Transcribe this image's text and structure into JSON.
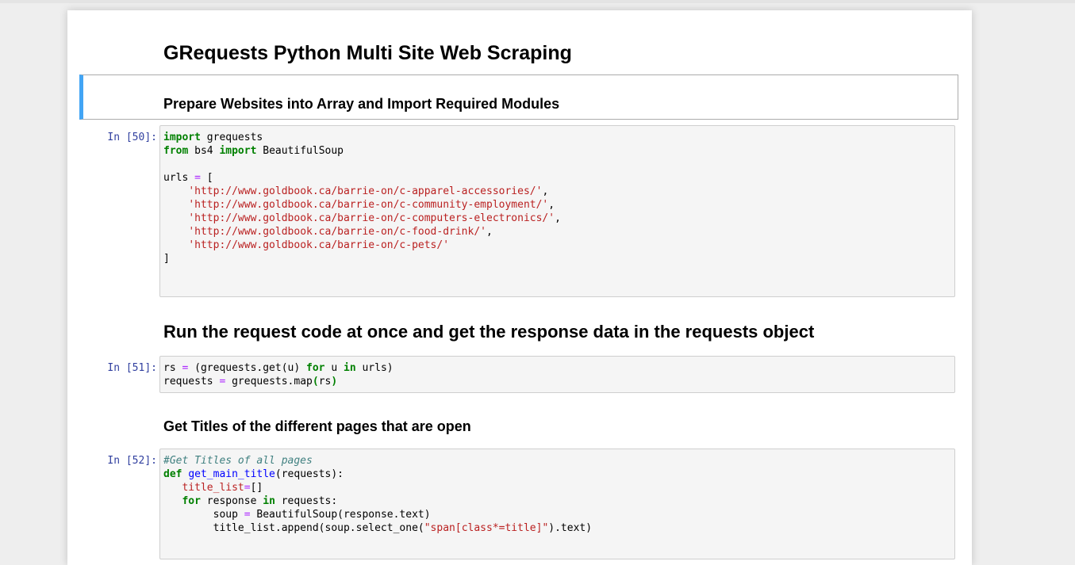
{
  "notebook": {
    "title": "GRequests Python Multi Site Web Scraping",
    "section1": "Prepare Websites into Array and Import Required Modules",
    "section2": "Run the request code at once and get the response data in the requests object",
    "section3": "Get Titles of the different pages that are open"
  },
  "cells": [
    {
      "prompt": "In [50]:",
      "lines": [
        [
          {
            "t": "import",
            "c": "kw"
          },
          {
            "t": " grequests",
            "c": ""
          }
        ],
        [
          {
            "t": "from",
            "c": "kw"
          },
          {
            "t": " bs4 ",
            "c": ""
          },
          {
            "t": "import",
            "c": "kw"
          },
          {
            "t": " BeautifulSoup",
            "c": ""
          }
        ],
        [],
        [
          {
            "t": "urls ",
            "c": ""
          },
          {
            "t": "=",
            "c": "op"
          },
          {
            "t": " [",
            "c": ""
          }
        ],
        [
          {
            "t": "    ",
            "c": ""
          },
          {
            "t": "'http://www.goldbook.ca/barrie-on/c-apparel-accessories/'",
            "c": "str"
          },
          {
            "t": ",",
            "c": ""
          }
        ],
        [
          {
            "t": "    ",
            "c": ""
          },
          {
            "t": "'http://www.goldbook.ca/barrie-on/c-community-employment/'",
            "c": "str"
          },
          {
            "t": ",",
            "c": ""
          }
        ],
        [
          {
            "t": "    ",
            "c": ""
          },
          {
            "t": "'http://www.goldbook.ca/barrie-on/c-computers-electronics/'",
            "c": "str"
          },
          {
            "t": ",",
            "c": ""
          }
        ],
        [
          {
            "t": "    ",
            "c": ""
          },
          {
            "t": "'http://www.goldbook.ca/barrie-on/c-food-drink/'",
            "c": "str"
          },
          {
            "t": ",",
            "c": ""
          }
        ],
        [
          {
            "t": "    ",
            "c": ""
          },
          {
            "t": "'http://www.goldbook.ca/barrie-on/c-pets/'",
            "c": "str"
          }
        ],
        [
          {
            "t": "]",
            "c": ""
          }
        ]
      ]
    },
    {
      "prompt": "In [51]:",
      "lines": [
        [
          {
            "t": "rs ",
            "c": ""
          },
          {
            "t": "=",
            "c": "op"
          },
          {
            "t": " (grequests.get(u) ",
            "c": ""
          },
          {
            "t": "for",
            "c": "kw"
          },
          {
            "t": " u ",
            "c": ""
          },
          {
            "t": "in",
            "c": "kw"
          },
          {
            "t": " urls)",
            "c": ""
          }
        ],
        [
          {
            "t": "requests ",
            "c": ""
          },
          {
            "t": "=",
            "c": "op"
          },
          {
            "t": " grequests.map",
            "c": ""
          },
          {
            "t": "(",
            "c": "kw"
          },
          {
            "t": "rs",
            "c": ""
          },
          {
            "t": ")",
            "c": "kw"
          }
        ]
      ]
    },
    {
      "prompt": "In [52]:",
      "lines": [
        [
          {
            "t": "#Get Titles of all pages",
            "c": "cm"
          }
        ],
        [
          {
            "t": "def",
            "c": "kw"
          },
          {
            "t": " ",
            "c": ""
          },
          {
            "t": "get_main_title",
            "c": "fn"
          },
          {
            "t": "(requests):",
            "c": ""
          }
        ],
        [
          {
            "t": "   ",
            "c": ""
          },
          {
            "t": "title_list",
            "c": "var"
          },
          {
            "t": "=",
            "c": "op"
          },
          {
            "t": "[]",
            "c": ""
          }
        ],
        [
          {
            "t": "   ",
            "c": ""
          },
          {
            "t": "for",
            "c": "kw"
          },
          {
            "t": " response ",
            "c": ""
          },
          {
            "t": "in",
            "c": "kw"
          },
          {
            "t": " requests:",
            "c": ""
          }
        ],
        [
          {
            "t": "        soup ",
            "c": ""
          },
          {
            "t": "=",
            "c": "op"
          },
          {
            "t": " BeautifulSoup(response.text)",
            "c": ""
          }
        ],
        [
          {
            "t": "        title_list.append(soup.select_one(",
            "c": ""
          },
          {
            "t": "\"span[class*=title]\"",
            "c": "str"
          },
          {
            "t": ").text)",
            "c": ""
          }
        ]
      ]
    }
  ]
}
